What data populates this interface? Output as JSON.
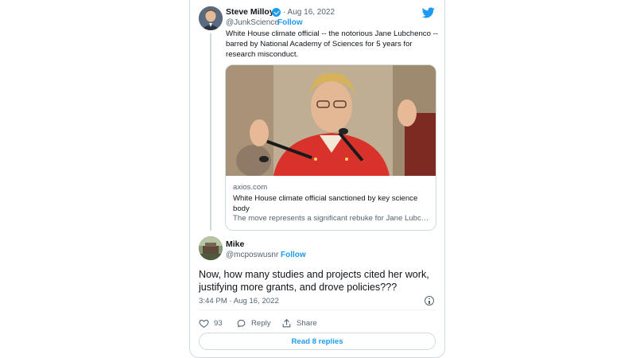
{
  "parent": {
    "name": "Steve Milloy",
    "date": "· Aug 16, 2022",
    "handle": "@JunkScience",
    "follow": "Follow",
    "text": "White House climate official -- the notorious Jane Lubchenco -- barred by National Academy of Sciences for 5 years for research misconduct.",
    "link_card": {
      "domain": "axios.com",
      "title": "White House climate official sanctioned by key science body",
      "description": "The move represents a significant rebuke for Jane Lubchenco, who is a top official in the White House"
    }
  },
  "tweet": {
    "name": "Mike",
    "handle": "@mcposwusnr",
    "follow": "Follow",
    "text": "Now, how many studies and projects cited her work, justifying more grants, and drove policies???",
    "timestamp": "3:44 PM · Aug 16, 2022",
    "likes": "93",
    "reply_label": "Reply",
    "share_label": "Share",
    "read_replies": "Read 8 replies"
  },
  "colors": {
    "accent": "#1d9bf0",
    "text": "#0f1419",
    "secondary": "#536471",
    "border": "#cfd9de"
  },
  "icons": [
    "verified-badge-icon",
    "twitter-bird-icon",
    "info-icon",
    "heart-icon",
    "reply-bubble-icon",
    "share-icon"
  ]
}
